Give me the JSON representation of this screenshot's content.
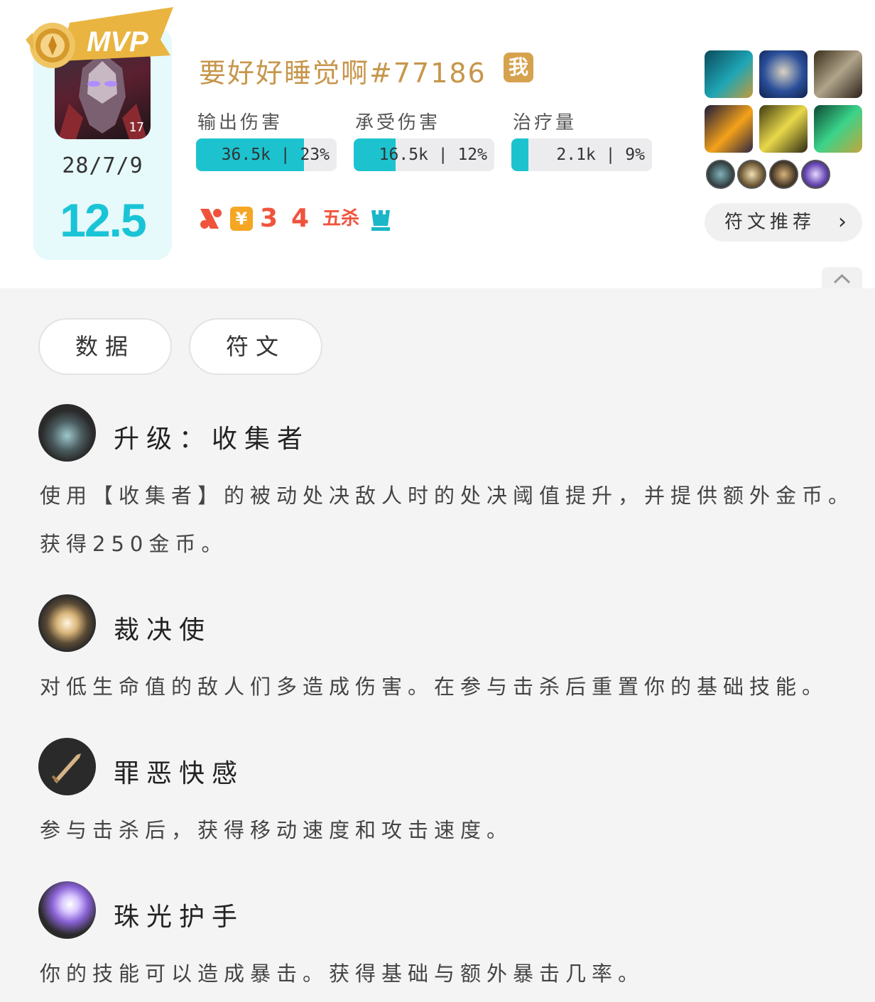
{
  "player": {
    "badge": "MVP",
    "champion_level": "17",
    "kda": "28/7/9",
    "score": "12.5",
    "name": "要好好睡觉啊#77186",
    "me_label": "我"
  },
  "stats": [
    {
      "label": "输出伤害",
      "text": "36.5k | 23%",
      "fill": 0.77
    },
    {
      "label": "承受伤害",
      "text": "16.5k | 12%",
      "fill": 0.3
    },
    {
      "label": "治疗量",
      "text": "2.1k | 9%",
      "fill": 0.12
    }
  ],
  "achievements": {
    "icons": [
      "percent-badge",
      "gold-badge",
      "triple-kill-badge",
      "quadra-kill-badge",
      "penta-kill-badge",
      "crown-badge"
    ],
    "triple": "3",
    "quadra": "4",
    "penta": "五杀",
    "gold_symbol": "¥"
  },
  "items": [
    "cannon-item",
    "spiked-shield-item",
    "boots-item",
    "blade-fire-item",
    "storm-blade-item",
    "green-sword-item"
  ],
  "mini_runes": [
    "collector-rune",
    "executioner-rune",
    "sword-rune",
    "gem-gauntlet-rune"
  ],
  "rune_recommend_label": "符文推荐",
  "tabs": [
    {
      "label": "数据"
    },
    {
      "label": "符文"
    }
  ],
  "runes": [
    {
      "title": "升级：收集者",
      "desc": "使用【收集者】的被动处决敌人时的处决阈值提升，并提供额外金币。获得250金币。",
      "icon": "collector-icon"
    },
    {
      "title": "裁决使",
      "desc": "对低生命值的敌人们多造成伤害。在参与击杀后重置你的基础技能。",
      "icon": "executioner-icon"
    },
    {
      "title": "罪恶快感",
      "desc": "参与击杀后，获得移动速度和攻击速度。",
      "icon": "sword-icon"
    },
    {
      "title": "珠光护手",
      "desc": "你的技能可以造成暴击。获得基础与额外暴击几率。",
      "icon": "gauntlet-icon"
    }
  ],
  "colors": {
    "accent": "#19c4d6",
    "gold": "#c7964b",
    "achievement": "#f0533c"
  }
}
